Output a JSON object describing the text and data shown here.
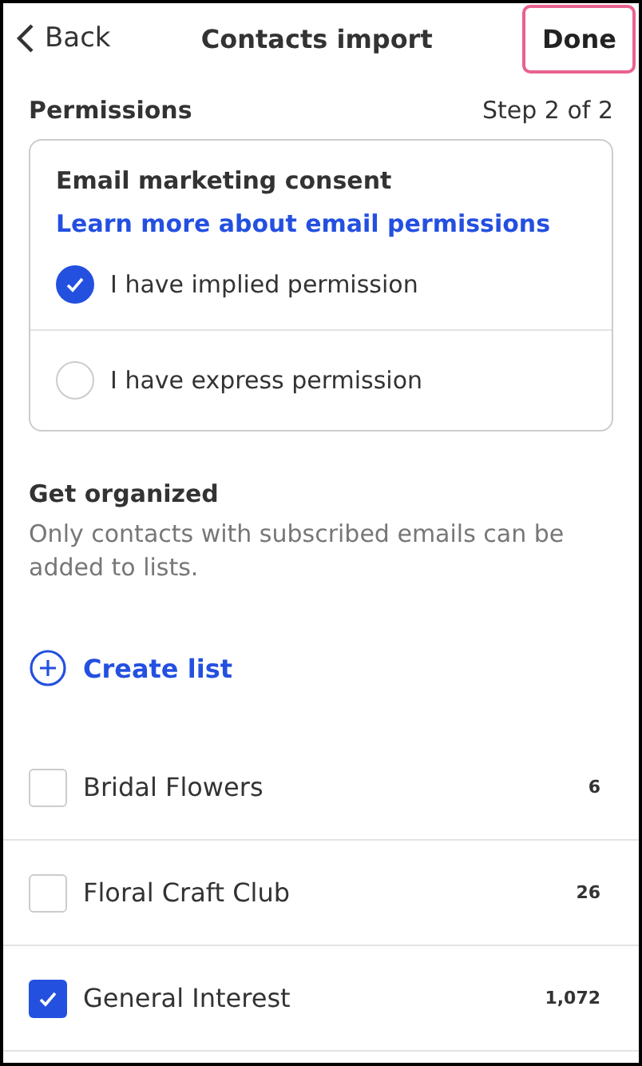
{
  "header": {
    "back": "Back",
    "title": "Contacts import",
    "done": "Done"
  },
  "permissions": {
    "title": "Permissions",
    "step": "Step 2 of 2"
  },
  "consent": {
    "title": "Email marketing consent",
    "link": "Learn more about email permissions",
    "options": [
      {
        "label": "I have implied permission",
        "selected": true
      },
      {
        "label": "I have express permission",
        "selected": false
      }
    ]
  },
  "organize": {
    "title": "Get organized",
    "description": "Only contacts with subscribed emails can be added to lists.",
    "create": "Create list"
  },
  "lists": [
    {
      "name": "Bridal Flowers",
      "count": "6",
      "checked": false
    },
    {
      "name": "Floral Craft Club",
      "count": "26",
      "checked": false
    },
    {
      "name": "General Interest",
      "count": "1,072",
      "checked": true
    }
  ]
}
